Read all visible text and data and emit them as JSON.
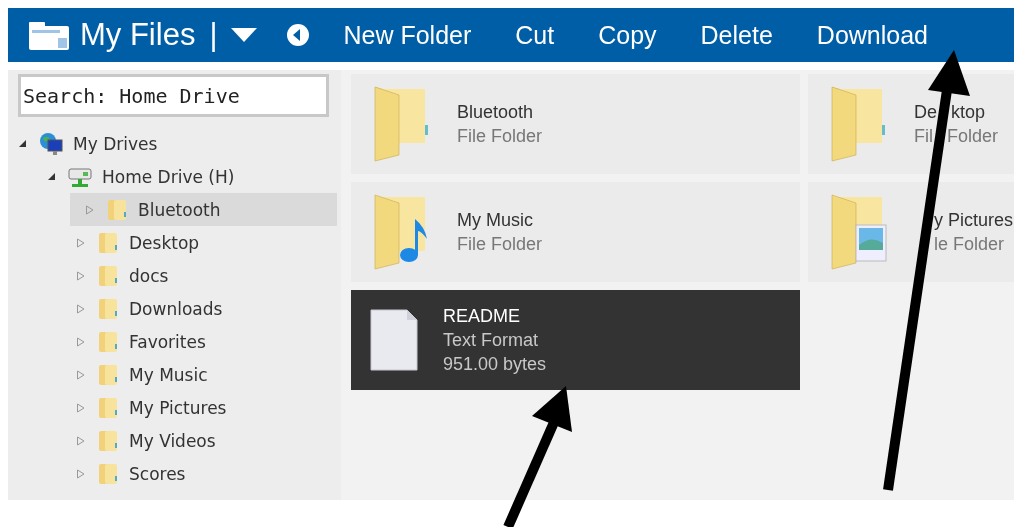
{
  "toolbar": {
    "title": "My Files",
    "separator": "|",
    "actions": [
      "New Folder",
      "Cut",
      "Copy",
      "Delete",
      "Download"
    ]
  },
  "sidebar": {
    "search": {
      "value": "Search: Home Drive"
    },
    "tree": [
      {
        "label": "My Drives",
        "kind": "drives",
        "expanded": true,
        "selected": false,
        "children": [
          {
            "label": "Home Drive (H)",
            "kind": "drive",
            "expanded": true,
            "selected": false,
            "children": [
              {
                "label": "Bluetooth",
                "kind": "folder",
                "expanded": false,
                "selected": true
              },
              {
                "label": "Desktop",
                "kind": "folder",
                "expanded": false,
                "selected": false
              },
              {
                "label": "docs",
                "kind": "folder",
                "expanded": false,
                "selected": false
              },
              {
                "label": "Downloads",
                "kind": "folder",
                "expanded": false,
                "selected": false
              },
              {
                "label": "Favorites",
                "kind": "folder",
                "expanded": false,
                "selected": false
              },
              {
                "label": "My Music",
                "kind": "folder",
                "expanded": false,
                "selected": false
              },
              {
                "label": "My Pictures",
                "kind": "folder",
                "expanded": false,
                "selected": false
              },
              {
                "label": "My Videos",
                "kind": "folder",
                "expanded": false,
                "selected": false
              },
              {
                "label": "Scores",
                "kind": "folder",
                "expanded": false,
                "selected": false
              }
            ]
          }
        ]
      }
    ]
  },
  "files": [
    {
      "name": "Bluetooth",
      "type": "File Folder",
      "kind": "folder",
      "selected": false
    },
    {
      "name_parts": [
        "De",
        "ktop"
      ],
      "type_parts": [
        "Fil",
        "Folder"
      ],
      "kind": "folder",
      "selected": false
    },
    {
      "name": "My Music",
      "type": "File Folder",
      "kind": "music",
      "selected": false
    },
    {
      "name_parts": [
        "y Pictures"
      ],
      "type_parts": [
        "le Folder"
      ],
      "covered_start": true,
      "kind": "pictures",
      "selected": false
    },
    {
      "name": "README",
      "type": "Text Format",
      "size": "951.00 bytes",
      "kind": "text",
      "selected": true
    }
  ]
}
